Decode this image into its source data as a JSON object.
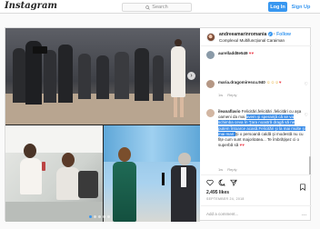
{
  "nav": {
    "logo": "Instagram",
    "search_placeholder": "Search",
    "login_label": "Log In",
    "signup_label": "Sign Up"
  },
  "post": {
    "username": "andreeamarinromania",
    "follow_label": "Follow",
    "location": "Complexul Multifuncțional Caraiman",
    "likes": "2,495 likes",
    "date": "SEPTEMBER 24, 2018",
    "add_comment_placeholder": "Add a comment..."
  },
  "comments": [
    {
      "user": "aurelladd8e549",
      "text": "",
      "meta": "",
      "reply": ""
    },
    {
      "user": "maria.dragomirescu.940",
      "text": "",
      "meta": "1w",
      "reply": "Reply"
    },
    {
      "user": "ileanaflavio",
      "text_pre": "Felicitări,felicitări ,felicitări cu aşa oameni da mai ",
      "text_hl": "avem şi speranţă că se va schimba ceva în Ţara noastră dragă să ne putem întoarce acasă.Felicitări şi la mai multe şi mai mari ",
      "text_post": "Şi o persoană caldă şi modestă nu cu fițe cum sunt majoritatea... Te îmbrățişez ci o superbă să",
      "meta": "1w",
      "reply": "Reply"
    }
  ],
  "icons": {
    "search": "search-icon",
    "verified": "verified-badge-icon",
    "like": "heart-icon",
    "comment": "comment-icon",
    "share": "share-icon",
    "save": "bookmark-icon",
    "more": "more-icon"
  },
  "colors": {
    "accent": "#3897f0",
    "text": "#262626",
    "muted": "#8e8e8e",
    "border": "#dbdbdb",
    "highlight": "#3b8de8"
  },
  "carousel": {
    "slide_count": 5,
    "active_index": 0
  }
}
